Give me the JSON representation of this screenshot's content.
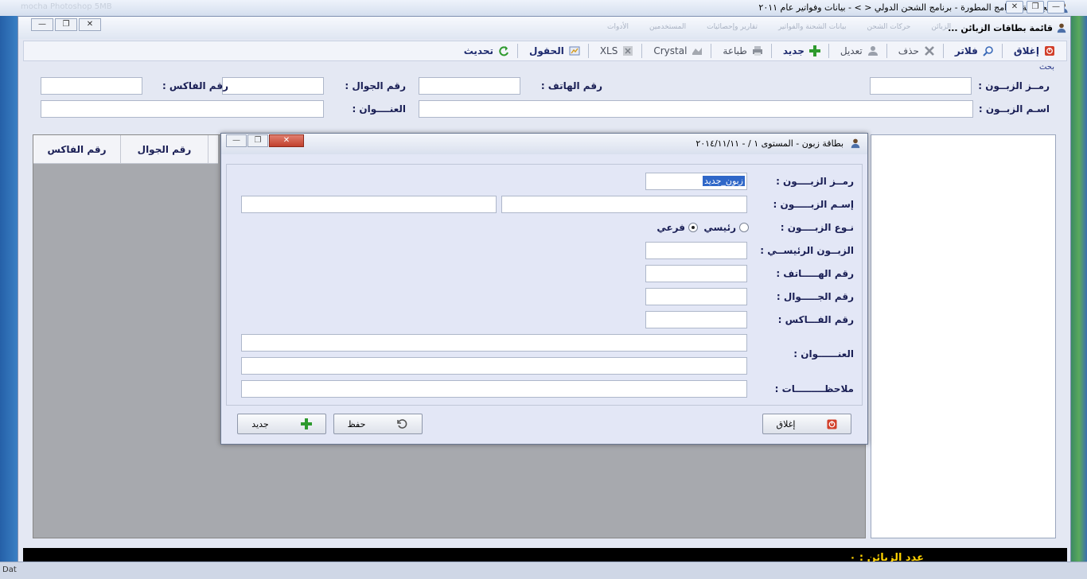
{
  "outer": {
    "title": "مجموعة البرامج المطورة - برنامج الشحن الدولي < > - بيانات وفواتير عام ٢٠١١",
    "faint": "mocha Photoshop 5MB"
  },
  "main": {
    "title": "قائمة بطاقات الزبائن ...",
    "menu_faint": [
      "الزبائن",
      "حركات الشحن",
      "بيانات الشحنة والفواتير",
      "تقارير وإحصائيات",
      "المستخدمين",
      "الأدوات"
    ],
    "toolbar": [
      {
        "label": "إغلاق",
        "icon": "close-icon",
        "grey": false
      },
      {
        "label": "فلاتر",
        "icon": "filter-icon",
        "grey": false
      },
      {
        "label": "حذف",
        "icon": "delete-icon",
        "grey": true
      },
      {
        "label": "تعديل",
        "icon": "edit-icon",
        "grey": true
      },
      {
        "label": "جديد",
        "icon": "add-icon",
        "grey": false
      },
      {
        "label": "طباعة",
        "icon": "print-icon",
        "grey": true
      },
      {
        "label": "Crystal",
        "icon": "crystal-icon",
        "grey": true
      },
      {
        "label": "XLS",
        "icon": "excel-icon",
        "grey": true
      },
      {
        "label": "الحقول",
        "icon": "fields-icon",
        "grey": false
      },
      {
        "label": "تحديث",
        "icon": "refresh-icon",
        "grey": false
      }
    ],
    "search": {
      "legend": "بحث",
      "customer_code": "رمــز الزبــون :",
      "phone": "رقم الهاتف :",
      "mobile": "رقم الجوال :",
      "fax": "رقم الفاكس :",
      "customer_name": "اسـم الزبــون :",
      "address": "العنــــوان :"
    },
    "grid_headers": [
      "رقم الفاكس",
      "رقم الجوال"
    ],
    "status": "عدد الزبائن : ٠",
    "bottom": "Dat"
  },
  "dialog": {
    "title": "بطاقة زبون - المستوى ١ / - ٢٠١٤/١١/١١",
    "labels": {
      "code": "رمــز الزبــــون :",
      "name": "إسـم الزبـــــون :",
      "type": "نـوع الزبــــون :",
      "parent": "الزبــون الرئيســي :",
      "phone": "رقم الهـــــاتف :",
      "mobile": "رقم الجـــــوال :",
      "fax": "رقم الفـــاكس :",
      "address": "العنــــــوان :",
      "notes": "ملاحظـــــــــات :"
    },
    "code_value": "زبون_جديد",
    "type_options": [
      "رئيسي",
      "فرعي"
    ],
    "type_selected": "فرعي",
    "buttons": {
      "close": "إغلاق",
      "save": "حفظ",
      "new": "جديد"
    }
  },
  "colors": {
    "status_text": "#ffd200",
    "selection": "#2f67c8",
    "dialog_bg": "#e3e7f6"
  }
}
